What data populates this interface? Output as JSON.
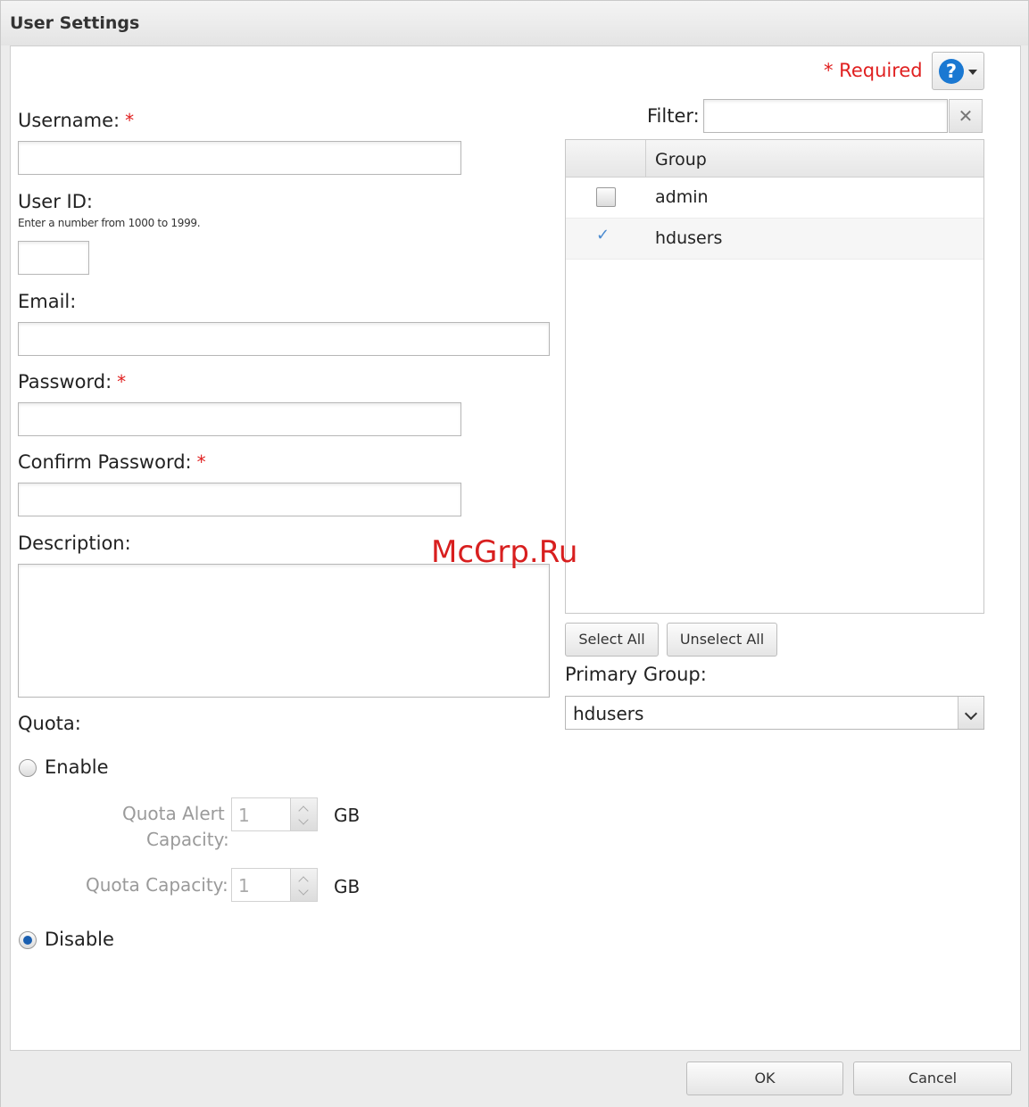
{
  "dialog": {
    "title": "User Settings",
    "required_note": "* Required",
    "help_icon": "question-mark-icon"
  },
  "form": {
    "username_label": "Username:",
    "user_id_label": "User ID:",
    "user_id_hint": "Enter a number from 1000 to 1999.",
    "email_label": "Email:",
    "password_label": "Password:",
    "confirm_password_label": "Confirm Password:",
    "description_label": "Description:",
    "required_marker": "*"
  },
  "quota": {
    "label": "Quota:",
    "enable_label": "Enable",
    "disable_label": "Disable",
    "selected": "Disable",
    "alert_capacity_label_line1": "Quota Alert",
    "alert_capacity_label_line2": "Capacity:",
    "alert_capacity_value": "1",
    "capacity_label": "Quota Capacity:",
    "capacity_value": "1",
    "unit": "GB"
  },
  "groups": {
    "filter_label": "Filter:",
    "filter_value": "",
    "column_header": "Group",
    "rows": [
      {
        "name": "admin",
        "checked": false
      },
      {
        "name": "hdusers",
        "checked": true
      }
    ],
    "select_all_label": "Select All",
    "unselect_all_label": "Unselect All",
    "primary_group_label": "Primary Group:",
    "primary_group_value": "hdusers"
  },
  "footer": {
    "ok_label": "OK",
    "cancel_label": "Cancel"
  },
  "watermark": "McGrp.Ru",
  "colors": {
    "required": "#e02020",
    "help_blue": "#1a78d2",
    "watermark": "#d81f1f"
  }
}
